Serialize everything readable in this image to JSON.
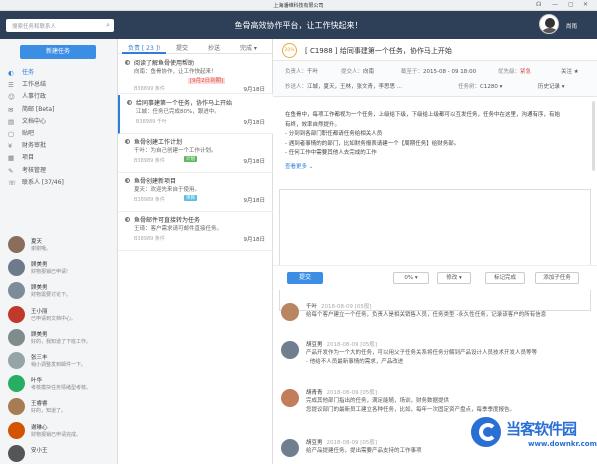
{
  "window": {
    "title": "上海潘维科技有限公司",
    "controls": [
      "☊",
      "—",
      "▢",
      "✕"
    ]
  },
  "header": {
    "slogan": "鱼骨高效协作平台，让工作快起来！",
    "search_placeholder": "搜索任务和联系人",
    "user_name": "尚雨"
  },
  "sidebar": {
    "new_task_label": "新建任务",
    "items": [
      {
        "label": "任务",
        "icon": "◐"
      },
      {
        "label": "工作总结",
        "icon": "☰"
      },
      {
        "label": "人事行政",
        "icon": "☺"
      },
      {
        "label": "简邮 [Beta]",
        "icon": "✉"
      },
      {
        "label": "文档中心",
        "icon": "▤"
      },
      {
        "label": "贴吧",
        "icon": "▢"
      },
      {
        "label": "财务审批",
        "icon": "¥"
      },
      {
        "label": "项目",
        "icon": "▦"
      },
      {
        "label": "考核管理",
        "icon": "✎"
      },
      {
        "label": "联系人 [37/46]",
        "icon": "☏"
      }
    ],
    "contacts": [
      {
        "name": "夏天",
        "msg": "谢谢哦。",
        "color": "#8a6d5b"
      },
      {
        "name": "顾美男",
        "msg": "财物报销已申请!",
        "color": "#6c7a89"
      },
      {
        "name": "顾美男",
        "msg": "财物需要讨论下。",
        "color": "#7d8c9b"
      },
      {
        "name": "王小丽",
        "msg": "已申请到文档中心。",
        "color": "#c0392b"
      },
      {
        "name": "顾美男",
        "msg": "好的，我知道了下班工作。",
        "color": "#7f8c8d"
      },
      {
        "name": "张三丰",
        "msg": "稍小调整发到邮件一下。",
        "color": "#95a5a6"
      },
      {
        "name": "叶华",
        "msg": "考核模块任务情绪型考核。",
        "color": "#27ae60"
      },
      {
        "name": "王睿睿",
        "msg": "好的，知道了。",
        "color": "#a67c52"
      },
      {
        "name": "谢琳心",
        "msg": "财物报销已申请完成。",
        "color": "#d35400"
      },
      {
        "name": "安小王",
        "msg": "",
        "color": "#555"
      }
    ]
  },
  "tasklist": {
    "tabs": [
      {
        "label": "负责 [ 23 ]",
        "dot": "!"
      },
      {
        "label": "提交"
      },
      {
        "label": "抄送"
      },
      {
        "label": "完成 ▾"
      }
    ],
    "tasks": [
      {
        "title": "阅读了解鱼骨使用帮助",
        "desc": "向南：鱼骨协作，让工作快起来！",
        "extra": "[9月2日到期]",
        "id": "B38899 条件",
        "date": "9月18日",
        "tag": ""
      },
      {
        "title": "给同事建第一个任务，协作马上开始",
        "desc": "江城：任务已完成80%，跟进中。",
        "extra": "",
        "id": "B38989 千叶",
        "date": "9月18日",
        "tag": ""
      },
      {
        "title": "鱼骨创建工作计划",
        "desc": "千叶：为自己创建一个工作计划。",
        "extra": "",
        "id": "B38989 条件",
        "date": "9月18日",
        "tag": "计划"
      },
      {
        "title": "鱼骨创建新项目",
        "desc": "夏天：欢迎先来自于使用。",
        "extra": "",
        "id": "B38989 条件",
        "date": "9月18日",
        "tag": "项目"
      },
      {
        "title": "鱼骨邮件可直接转为任务",
        "desc": "王琦：客户需求请可邮件直接任务。",
        "extra": "",
        "id": "B38989 条件",
        "date": "9月18日",
        "tag": ""
      }
    ]
  },
  "detail": {
    "badge": "20%",
    "title": "[ C1988 ]  给同事建第一个任务，协作马上开始",
    "meta_row1": [
      {
        "label": "负责人：",
        "value": "千叶"
      },
      {
        "label": "提交人：",
        "value": "向南"
      },
      {
        "label": "截至于：",
        "value": "2015-08 - 09 18:00"
      },
      {
        "label": "优先级：",
        "value": "紧急"
      },
      {
        "label": "",
        "value": "关注 ★"
      }
    ],
    "meta_row2": [
      {
        "label": "抄送人：",
        "value": "江城，夏天，王林，张文青，李思思 ..."
      },
      {
        "label": "任务树：",
        "value": "C1280 ▾"
      },
      {
        "label": "",
        "value": "历史记录 ▾"
      }
    ],
    "description": [
      "在鱼骨中，每项工作都视为一个任务，上级给下级，下级给上级都可以互发任务，任务中在这里，沟通有序，有始",
      "有终，效率自然提升。",
      "- 分到到各部门职任都请任务给相关人员",
      "- 遇到者事情的的部门，比如财务报表请建一个【周期任务】给财务部。",
      "- 任何工作中需要其他人去完成的工作"
    ],
    "more_label": "查看更多 ⌄",
    "submit_label": "提交",
    "percent_label": "0% ▾",
    "edit_label": "修改 ▾",
    "mark_done_label": "标记完成",
    "add_subtask_label": "添加子任务",
    "feed": [
      {
        "name": "千叶",
        "date": "2018-08-09 [05般]",
        "lines": [
          "给每个客户建立一个任务，负责人是相关销售人员，任务类型 -永久性任务，记录该客户的所有信息"
        ],
        "color": "#b88660"
      },
      {
        "name": "胡豆男",
        "date": "2018-08-09 [05般]",
        "lines": [
          "产品开发作为一个大的任务，可以用父子任务关系将任务分解到产品设计人员技术开发人员等等",
          "- 他给不人员最新事情的需求，产品改进"
        ],
        "color": "#6f7f8f"
      },
      {
        "name": "胡青青",
        "date": "2018-08-09 [05般]",
        "lines": [
          "完成其他部门指出的任务，满足能随，场训，财务数据提供",
          "您提议部门的最新员工建立各种任务，比如，每年一次固定资产盘点，每季季度报告。"
        ],
        "color": "#c27d5a"
      },
      {
        "name": "胡豆男",
        "date": "2018-08-09 [05般]",
        "lines": [
          "给产品提建任务，提出需要产品支持的工作事项"
        ],
        "color": "#6f7f8f"
      }
    ]
  },
  "watermark": {
    "title": "当客软件园",
    "url": "www.downkr.com"
  }
}
